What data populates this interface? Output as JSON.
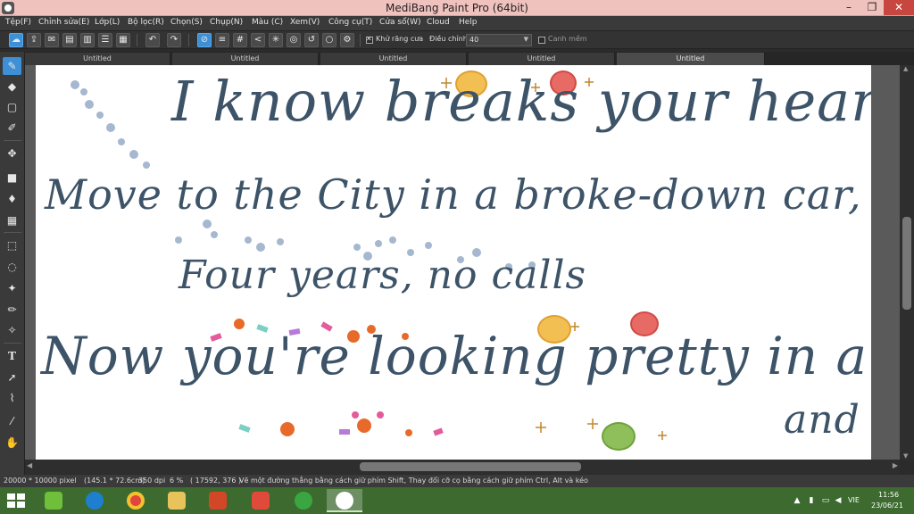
{
  "window": {
    "title": "MediBang Paint Pro (64bit)",
    "minimize": "–",
    "maximize": "❐",
    "close": "✕"
  },
  "menu": [
    "Tệp(F)",
    "Chỉnh sửa(E)",
    "Lớp(L)",
    "Bộ lọc(R)",
    "Chọn(S)",
    "Chụp(N)",
    "Màu (C)",
    "Xem(V)",
    "Công cụ(T)",
    "Cửa sổ(W)",
    "Cloud",
    "Help"
  ],
  "toolbar": {
    "antialias_label": "Khử răng cưa",
    "adjust_label": "Điều chỉnh",
    "adjust_value": "40",
    "canh_mem_label": "Canh mềm"
  },
  "tabs": [
    "Untitled",
    "Untitled",
    "Untitled",
    "Untitled",
    "Untitled"
  ],
  "canvas_text": {
    "line1": "I know breaks your heart",
    "line2": "Move to the City in a broke-down car, and",
    "line3": "Four years, no calls",
    "line4": "Now you're looking pretty in a hotel bar,",
    "line5": "and ..."
  },
  "status": {
    "size": "20000 * 10000 pixel",
    "cm": "(145.1 * 72.6cm)",
    "dpi": "350 dpi",
    "zoom": "6 %",
    "coords": "( 17592, 376 )",
    "hint": "Vẽ một đường thẳng bằng cách giữ phím Shift, Thay đổi cỡ cọ bằng cách giữ phím Ctrl, Alt và kéo"
  },
  "taskbar": {
    "lang": "VIE",
    "time": "11:56",
    "date": "23/06/21"
  },
  "colors": {
    "ink": "#3d5368",
    "accent": "#3d8fd6",
    "taskbar": "#3c6a2f"
  }
}
